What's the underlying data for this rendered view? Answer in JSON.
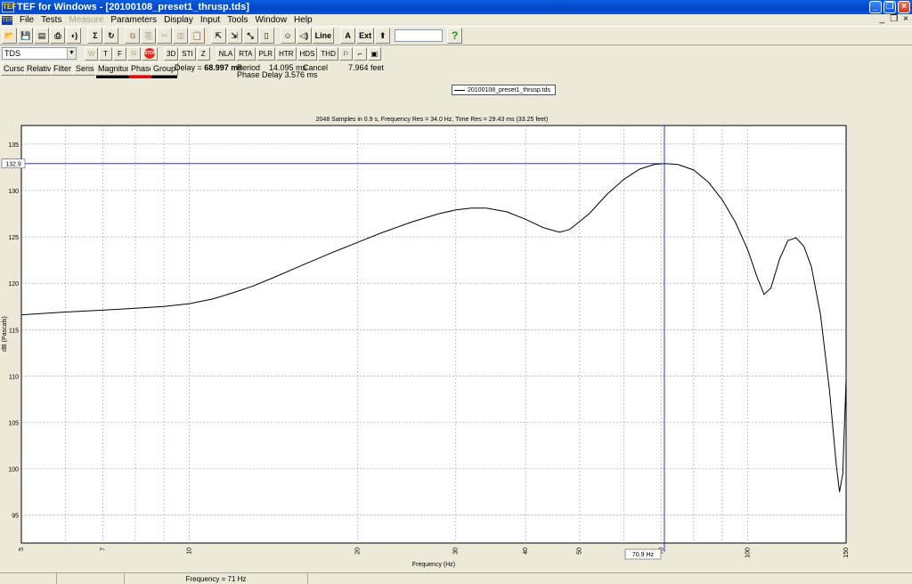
{
  "window": {
    "title": "TEF for Windows - [20100108_preset1_thrusp.tds]",
    "app_icon": "TEF"
  },
  "menu": {
    "items": [
      {
        "label": "File",
        "enabled": true
      },
      {
        "label": "Tests",
        "enabled": true
      },
      {
        "label": "Measure",
        "enabled": false
      },
      {
        "label": "Parameters",
        "enabled": true
      },
      {
        "label": "Display",
        "enabled": true
      },
      {
        "label": "Input",
        "enabled": true
      },
      {
        "label": "Tools",
        "enabled": true
      },
      {
        "label": "Window",
        "enabled": true
      },
      {
        "label": "Help",
        "enabled": true
      }
    ]
  },
  "toolbar1": {
    "sigma": "Σ",
    "line_button": "Line",
    "a_button": "A",
    "ext_button": "Ext",
    "help": "?"
  },
  "toolbar2": {
    "mode": "TDS",
    "w": "W",
    "t": "T",
    "f": "F",
    "r": "R",
    "stop": "STOP",
    "three_d": "3D",
    "sti": "STI",
    "z": "Z",
    "nla": "NLA",
    "rta": "RTA",
    "plr": "PLR",
    "htr": "HTR",
    "hds": "HDS",
    "thd": "THD"
  },
  "tabs": {
    "cursor": "Cursor",
    "relative": "Relative",
    "filter": "Filter",
    "sens": "Sens",
    "magnitude": "Magnitude",
    "phase": "Phase",
    "group": "Group"
  },
  "info": {
    "delay_label": "Delay = ",
    "delay_value": "68.997 ms",
    "period": "Period",
    "period_value": "14.095 ms",
    "phase_delay": "Phase Delay 3.576 ms",
    "cancel": "Cancel",
    "distance": "7.964 feet"
  },
  "legend": {
    "file": "20100108_preset1_thrusp.tds"
  },
  "colors": {
    "magnitude": "#000000",
    "phase": "#ff0000",
    "group": "#000000",
    "cursor": "#3333cc"
  },
  "chart_data": {
    "type": "line",
    "title": "2048 Samples in 0.9 s, Frequency Res = 34.0 Hz, Time Res = 29.43 ms (33.25 feet)",
    "xlabel": "Frequency (Hz)",
    "ylabel": "dB (Pascals)",
    "xscale": "log",
    "xlim": [
      5,
      150
    ],
    "ylim": [
      92,
      137
    ],
    "x_tick_labels": [
      {
        "v": 5,
        "t": "5"
      },
      {
        "v": 7,
        "t": "7"
      },
      {
        "v": 10,
        "t": "10"
      },
      {
        "v": 20,
        "t": "20"
      },
      {
        "v": 30,
        "t": "30"
      },
      {
        "v": 40,
        "t": "40"
      },
      {
        "v": 50,
        "t": "50"
      },
      {
        "v": 70,
        "t": "70"
      },
      {
        "v": 100,
        "t": "100"
      },
      {
        "v": 150,
        "t": "150"
      }
    ],
    "x_gridlines": [
      6,
      7,
      8,
      9,
      10,
      20,
      30,
      40,
      50,
      60,
      70,
      80,
      90,
      100
    ],
    "y_ticks": [
      95,
      100,
      105,
      110,
      115,
      120,
      125,
      130,
      135
    ],
    "grid": true,
    "cursor": {
      "x": 70.9,
      "y": 132.9,
      "x_label": "70.9 Hz",
      "y_label": "132.9"
    },
    "status": "Frequency = 71 Hz",
    "series": [
      {
        "x": [
          5,
          6,
          7,
          8,
          9,
          10,
          11,
          12,
          13,
          14,
          16,
          18,
          20,
          22,
          25,
          28,
          30,
          32,
          34,
          37,
          40,
          43,
          46,
          48,
          52,
          56,
          60,
          64,
          68,
          71,
          75,
          80,
          85,
          90,
          95,
          100,
          104,
          107,
          110,
          114,
          118,
          122,
          126,
          130,
          135,
          140,
          144,
          146,
          148,
          149,
          150
        ],
        "y": [
          116.6,
          116.9,
          117.1,
          117.3,
          117.5,
          117.8,
          118.3,
          119.0,
          119.7,
          120.5,
          122.0,
          123.3,
          124.4,
          125.4,
          126.6,
          127.5,
          127.9,
          128.1,
          128.1,
          127.7,
          126.9,
          126.0,
          125.5,
          125.8,
          127.5,
          129.6,
          131.2,
          132.3,
          132.8,
          132.9,
          132.8,
          132.2,
          130.9,
          129.0,
          126.6,
          123.6,
          120.6,
          118.8,
          119.5,
          122.6,
          124.6,
          124.9,
          124.0,
          121.8,
          116.6,
          108.6,
          100.5,
          97.5,
          99.5,
          104.8,
          109.6
        ]
      }
    ]
  }
}
